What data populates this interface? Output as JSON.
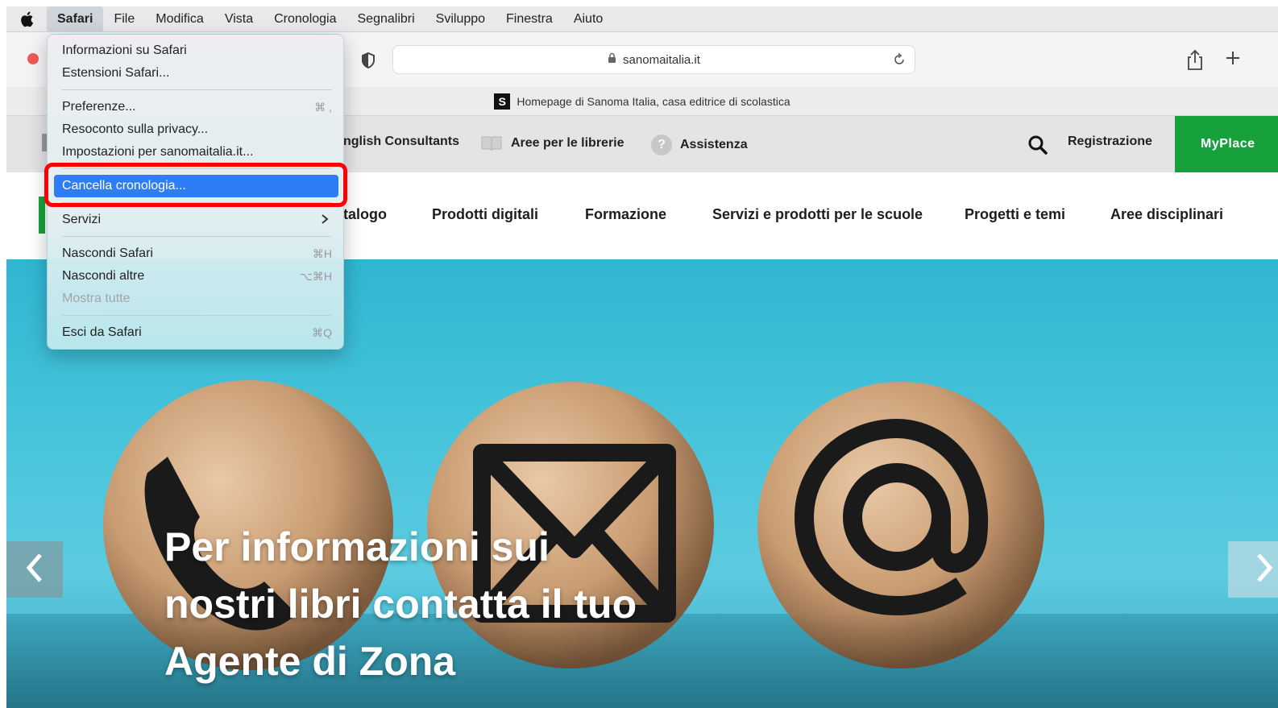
{
  "menubar": {
    "items": [
      "Safari",
      "File",
      "Modifica",
      "Vista",
      "Cronologia",
      "Segnalibri",
      "Sviluppo",
      "Finestra",
      "Aiuto"
    ]
  },
  "browser": {
    "url": "sanomaitalia.it",
    "tab_title": "Homepage di Sanoma Italia, casa editrice di scolastica",
    "favicon_letter": "S"
  },
  "site": {
    "util_links": [
      "nglish Consultants",
      "Aree per le librerie",
      "Assistenza"
    ],
    "register": "Registrazione",
    "myplace": "MyPlace",
    "nav": [
      "talogo",
      "Prodotti digitali",
      "Formazione",
      "Servizi e prodotti per le scuole",
      "Progetti e temi",
      "Aree disciplinari"
    ],
    "hero_title": "Per informazioni sui nostri libri contatta il tuo Agente di Zona"
  },
  "dropdown": {
    "items": [
      {
        "label": "Informazioni su Safari",
        "shortcut": ""
      },
      {
        "label": "Estensioni Safari...",
        "shortcut": ""
      },
      {
        "label": "Preferenze...",
        "shortcut": "⌘ ,"
      },
      {
        "label": "Resoconto sulla privacy...",
        "shortcut": ""
      },
      {
        "label": "Impostazioni per sanomaitalia.it...",
        "shortcut": ""
      },
      {
        "label": "Cancella cronologia...",
        "shortcut": ""
      },
      {
        "label": "Servizi",
        "shortcut": ">"
      },
      {
        "label": "Nascondi Safari",
        "shortcut": "⌘H"
      },
      {
        "label": "Nascondi altre",
        "shortcut": "⌥⌘H"
      },
      {
        "label": "Mostra tutte",
        "shortcut": ""
      },
      {
        "label": "Esci da Safari",
        "shortcut": "⌘Q"
      }
    ]
  },
  "colors": {
    "highlight": "#2f7cf6",
    "annotation": "#ff0000",
    "brand_green": "#17a13c",
    "hero_blue": "#48c4db"
  },
  "icons": [
    "apple-icon",
    "shield-icon",
    "lock-icon",
    "reload-icon",
    "share-icon",
    "plus-icon",
    "search-icon",
    "book-icon",
    "help-icon",
    "chevron-left-icon",
    "chevron-right-icon"
  ]
}
